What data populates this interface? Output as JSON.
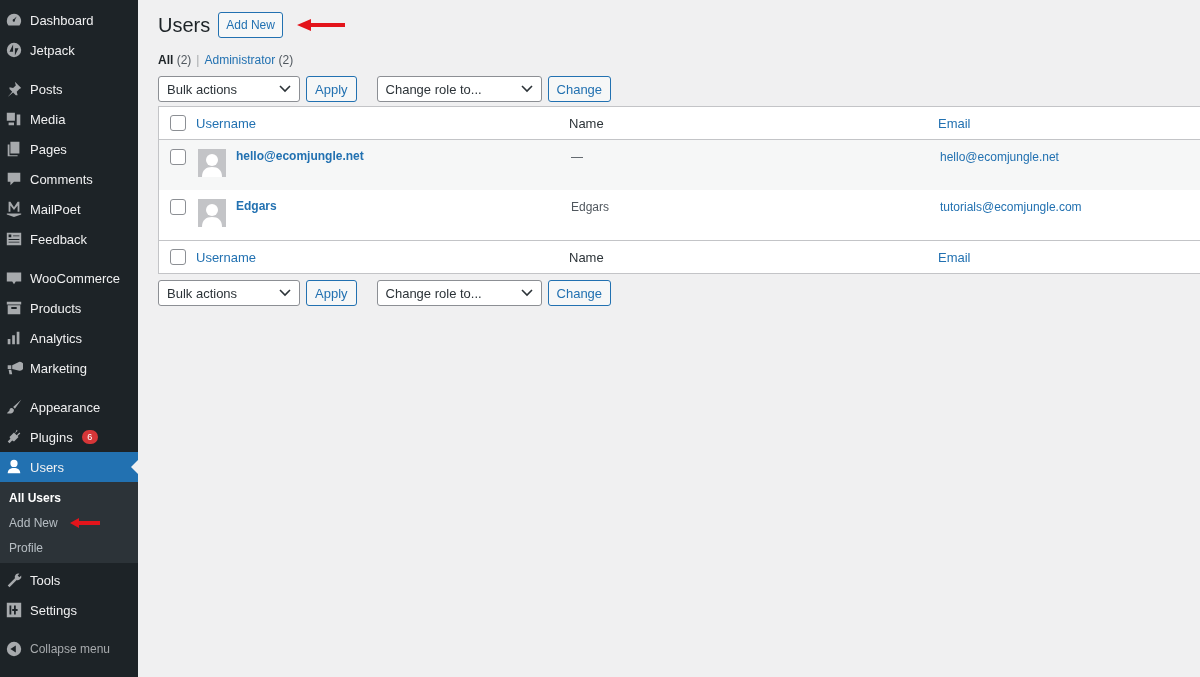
{
  "sidebar": {
    "groups": [
      [
        {
          "label": "Dashboard",
          "selected": false
        },
        {
          "label": "Jetpack",
          "selected": false
        }
      ],
      [
        {
          "label": "Posts",
          "selected": false
        },
        {
          "label": "Media",
          "selected": false
        },
        {
          "label": "Pages",
          "selected": false
        },
        {
          "label": "Comments",
          "selected": false
        },
        {
          "label": "MailPoet",
          "selected": false
        },
        {
          "label": "Feedback",
          "selected": false
        }
      ],
      [
        {
          "label": "WooCommerce",
          "selected": false
        },
        {
          "label": "Products",
          "selected": false
        },
        {
          "label": "Analytics",
          "selected": false
        },
        {
          "label": "Marketing",
          "selected": false
        }
      ],
      [
        {
          "label": "Appearance",
          "selected": false
        },
        {
          "label": "Plugins",
          "selected": false,
          "badge": "6"
        },
        {
          "label": "Users",
          "selected": true,
          "submenu": [
            {
              "label": "All Users",
              "selected": true
            },
            {
              "label": "Add New",
              "selected": false
            },
            {
              "label": "Profile",
              "selected": false
            }
          ]
        },
        {
          "label": "Tools",
          "selected": false
        },
        {
          "label": "Settings",
          "selected": false
        }
      ]
    ],
    "collapse": "Collapse menu"
  },
  "page": {
    "title": "Users",
    "add_new": "Add New"
  },
  "filter_separator": "|",
  "filters": [
    {
      "label": "All",
      "count": "(2)",
      "selected": true
    },
    {
      "label": "Administrator",
      "count": "(2)",
      "selected": false
    }
  ],
  "tablenav_top": {
    "bulk_actions": "Bulk actions",
    "apply": "Apply",
    "change_role": "Change role to...",
    "change": "Change"
  },
  "table": {
    "select_all_checked": false,
    "footer_select_all_checked": false,
    "columns": [
      "Username",
      "Name",
      "Email"
    ],
    "rows": [
      {
        "checked": false,
        "username": "hello@ecomjungle.net",
        "name": "—",
        "email": "hello@ecomjungle.net"
      },
      {
        "checked": false,
        "username": "Edgars",
        "name": "Edgars",
        "email": "tutorials@ecomjungle.com"
      }
    ],
    "footer_columns": [
      "Username",
      "Name",
      "Email"
    ]
  },
  "tablenav_bottom": {
    "bulk_actions": "Bulk actions",
    "apply": "Apply",
    "change_role": "Change role to...",
    "change": "Change"
  }
}
